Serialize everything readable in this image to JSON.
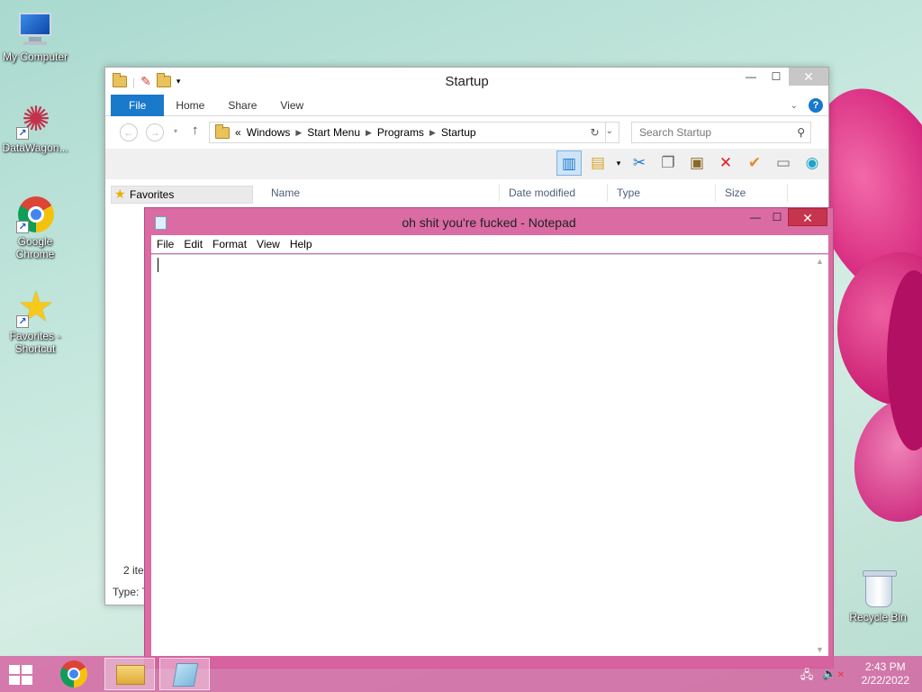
{
  "desktop": {
    "icons": [
      {
        "label": "My Computer"
      },
      {
        "label": "DataWagon..."
      },
      {
        "label": "Google Chrome"
      },
      {
        "label": "Favorites - Shortcut"
      },
      {
        "label": "Recycle Bin"
      }
    ]
  },
  "explorer": {
    "title": "Startup",
    "tabs": [
      "File",
      "Home",
      "Share",
      "View"
    ],
    "address": {
      "prefix": "«",
      "crumbs": [
        "Windows",
        "Start Menu",
        "Programs",
        "Startup"
      ]
    },
    "search_placeholder": "Search Startup",
    "favorites": "Favorites",
    "columns": [
      "Name",
      "Date modified",
      "Type",
      "Size"
    ],
    "status_count": "2 ite",
    "status_type": "Type: T"
  },
  "notepad": {
    "title": "oh shit you're fucked - Notepad",
    "menu": [
      "File",
      "Edit",
      "Format",
      "View",
      "Help"
    ],
    "content": ""
  },
  "taskbar": {
    "time": "2:43 PM",
    "date": "2/22/2022"
  },
  "icons": {
    "start": "windows-logo-icon",
    "chrome": "chrome-icon",
    "explorer": "folder-icon",
    "notepad": "notepad-icon",
    "network": "network-icon",
    "volume": "volume-muted-icon"
  },
  "colors": {
    "accent": "#1979ca",
    "notepad_frame": "#da6ba3",
    "taskbar": "#d560a0",
    "close_button": "#c7344d"
  }
}
